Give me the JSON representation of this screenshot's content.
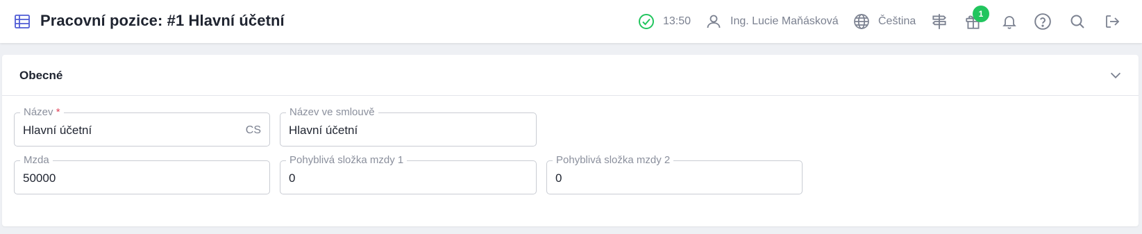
{
  "header": {
    "title": "Pracovní pozice: #1 Hlavní účetní",
    "page_icon": "table-icon",
    "time": "13:50",
    "user": "Ing. Lucie Maňásková",
    "language": "Čeština",
    "gift_badge": "1",
    "accent_color": "#4f5bd5",
    "status_color": "#22c55e",
    "icons": [
      "check-circle-icon",
      "user-icon",
      "globe-icon",
      "signpost-icon",
      "gift-icon",
      "bell-icon",
      "help-icon",
      "search-icon",
      "logout-icon"
    ]
  },
  "section": {
    "title": "Obecné",
    "collapse_icon": "chevron-down-icon"
  },
  "form": {
    "name": {
      "label": "Název",
      "required_mark": "*",
      "value": "Hlavní účetní",
      "suffix": "CS"
    },
    "contract_name": {
      "label": "Název ve smlouvě",
      "value": "Hlavní účetní"
    },
    "salary": {
      "label": "Mzda",
      "value": "50000"
    },
    "variable_pay_1": {
      "label": "Pohyblivá složka mzdy 1",
      "value": "0"
    },
    "variable_pay_2": {
      "label": "Pohyblivá složka mzdy 2",
      "value": "0"
    }
  }
}
